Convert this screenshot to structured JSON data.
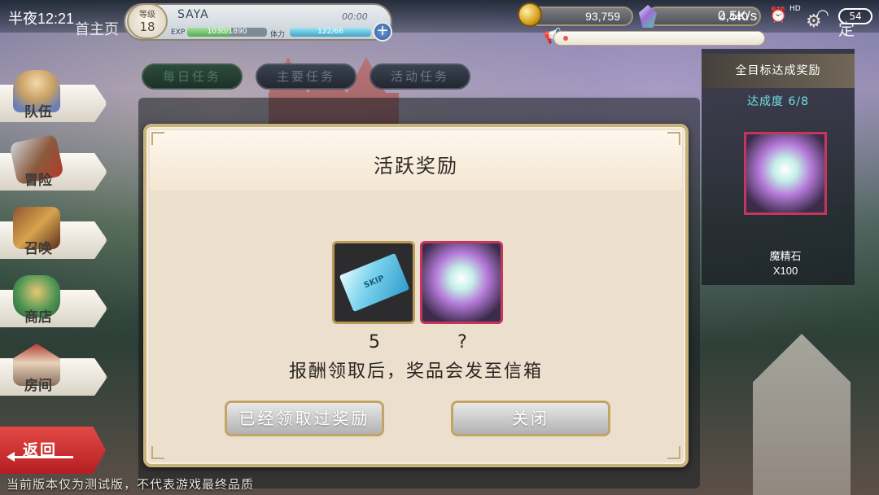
{
  "status_bar": {
    "time": "半夜12:21",
    "net_speed": "0.5K/s",
    "hd_label": "HD",
    "battery": "54"
  },
  "corner_text": {
    "left": "首主页",
    "right": "定"
  },
  "player": {
    "level_label": "等级",
    "level": "18",
    "name": "SAYA",
    "timer": "00:00",
    "exp_label": "EXP",
    "exp_text": "1030/1890",
    "exp_progress": 0.545,
    "stamina_label": "体力",
    "stamina_text": "122/66",
    "stamina_progress": 1.0
  },
  "currencies": {
    "coins": "93,759",
    "gems": "4,440"
  },
  "tabs": [
    {
      "label": "每日任务",
      "active": true
    },
    {
      "label": "主要任务",
      "active": false
    },
    {
      "label": "活动任务",
      "active": false
    }
  ],
  "nav": {
    "team": "队伍",
    "adventure": "冒险",
    "summon": "召唤",
    "shop": "商店",
    "room": "房间",
    "back": "返回"
  },
  "side_panel": {
    "title": "全目标达成奖励",
    "progress": "达成度 6/8",
    "item_name": "魔精石",
    "item_qty": "X100"
  },
  "modal": {
    "title": "活跃奖励",
    "skip_label": "SKIP",
    "skip_qty": "5",
    "crystal_qty": "?",
    "notice": "报酬领取后，奖品会发至信箱",
    "claimed_button": "已经领取过奖励",
    "close_button": "关闭"
  },
  "footer": "当前版本仅为测试版，不代表游戏最终品质",
  "colors": {
    "accent_red": "#c6365c",
    "progress_cyan": "#6fe0e6",
    "frame_gold": "#c8b27c"
  }
}
